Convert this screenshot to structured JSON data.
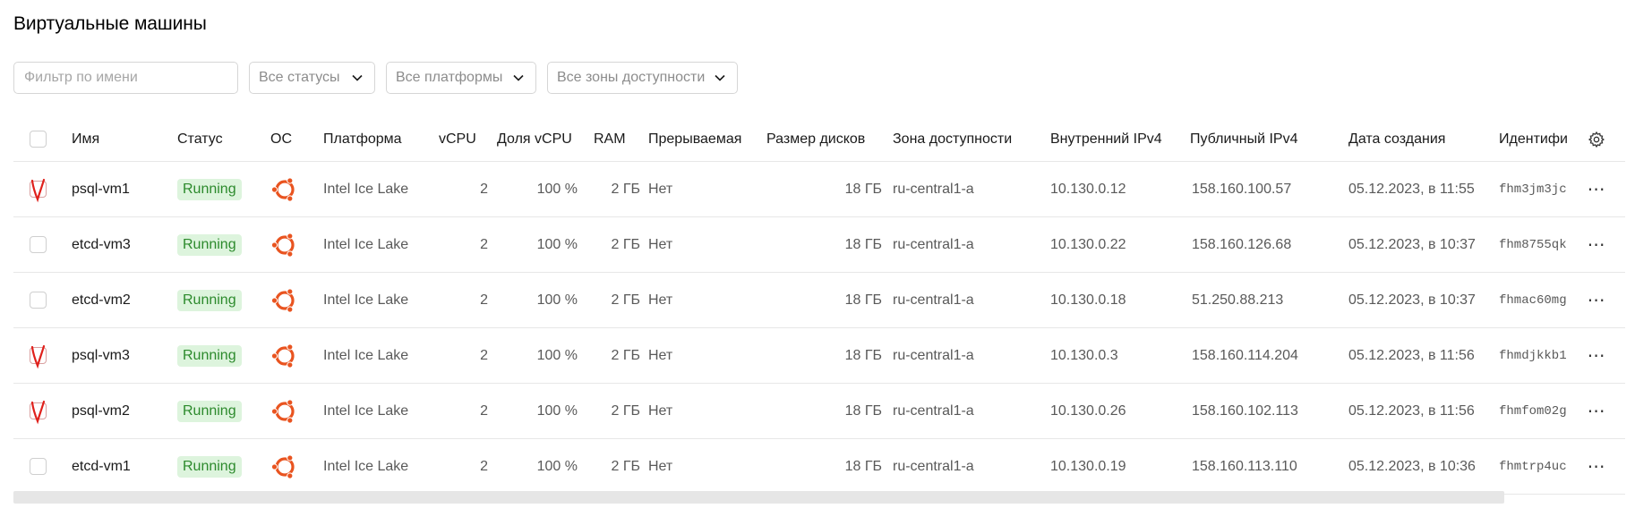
{
  "page": {
    "title": "Виртуальные машины"
  },
  "filters": {
    "name_placeholder": "Фильтр по имени",
    "status": "Все статусы",
    "platform": "Все платформы",
    "zone": "Все зоны доступности"
  },
  "table": {
    "headers": {
      "name": "Имя",
      "status": "Статус",
      "os": "ОС",
      "platform": "Платформа",
      "vcpu": "vCPU",
      "vcpu_share": "Доля vCPU",
      "ram": "RAM",
      "preemptible": "Прерываемая",
      "disk_size": "Размер дисков",
      "zone": "Зона доступности",
      "internal_ip": "Внутренний IPv4",
      "public_ip": "Публичный IPv4",
      "created": "Дата создания",
      "id": "Идентифи"
    },
    "rows": [
      {
        "marked": true,
        "name": "psql-vm1",
        "status": "Running",
        "os_icon": "ubuntu-icon",
        "platform": "Intel Ice Lake",
        "vcpu": "2",
        "vcpu_share": "100 %",
        "ram": "2 ГБ",
        "preemptible": "Нет",
        "disk_size": "18 ГБ",
        "zone": "ru-central1-a",
        "internal_ip": "10.130.0.12",
        "public_ip": "158.160.100.57",
        "created": "05.12.2023, в 11:55",
        "id": "fhm3jm3jc"
      },
      {
        "marked": false,
        "name": "etcd-vm3",
        "status": "Running",
        "os_icon": "ubuntu-icon",
        "platform": "Intel Ice Lake",
        "vcpu": "2",
        "vcpu_share": "100 %",
        "ram": "2 ГБ",
        "preemptible": "Нет",
        "disk_size": "18 ГБ",
        "zone": "ru-central1-a",
        "internal_ip": "10.130.0.22",
        "public_ip": "158.160.126.68",
        "created": "05.12.2023, в 10:37",
        "id": "fhm8755qk"
      },
      {
        "marked": false,
        "name": "etcd-vm2",
        "status": "Running",
        "os_icon": "ubuntu-icon",
        "platform": "Intel Ice Lake",
        "vcpu": "2",
        "vcpu_share": "100 %",
        "ram": "2 ГБ",
        "preemptible": "Нет",
        "disk_size": "18 ГБ",
        "zone": "ru-central1-a",
        "internal_ip": "10.130.0.18",
        "public_ip": "51.250.88.213",
        "created": "05.12.2023, в 10:37",
        "id": "fhmac60mg"
      },
      {
        "marked": true,
        "name": "psql-vm3",
        "status": "Running",
        "os_icon": "ubuntu-icon",
        "platform": "Intel Ice Lake",
        "vcpu": "2",
        "vcpu_share": "100 %",
        "ram": "2 ГБ",
        "preemptible": "Нет",
        "disk_size": "18 ГБ",
        "zone": "ru-central1-a",
        "internal_ip": "10.130.0.3",
        "public_ip": "158.160.114.204",
        "created": "05.12.2023, в 11:56",
        "id": "fhmdjkkb1"
      },
      {
        "marked": true,
        "name": "psql-vm2",
        "status": "Running",
        "os_icon": "ubuntu-icon",
        "platform": "Intel Ice Lake",
        "vcpu": "2",
        "vcpu_share": "100 %",
        "ram": "2 ГБ",
        "preemptible": "Нет",
        "disk_size": "18 ГБ",
        "zone": "ru-central1-a",
        "internal_ip": "10.130.0.26",
        "public_ip": "158.160.102.113",
        "created": "05.12.2023, в 11:56",
        "id": "fhmfom02g"
      },
      {
        "marked": false,
        "name": "etcd-vm1",
        "status": "Running",
        "os_icon": "ubuntu-icon",
        "platform": "Intel Ice Lake",
        "vcpu": "2",
        "vcpu_share": "100 %",
        "ram": "2 ГБ",
        "preemptible": "Нет",
        "disk_size": "18 ГБ",
        "zone": "ru-central1-a",
        "internal_ip": "10.130.0.19",
        "public_ip": "158.160.113.110",
        "created": "05.12.2023, в 10:36",
        "id": "fhmtrp4uc"
      }
    ]
  },
  "colors": {
    "status_bg": "#ddf4dd",
    "status_text": "#2c8a2c",
    "ubuntu": "#e95420",
    "mark": "#e0201b"
  }
}
